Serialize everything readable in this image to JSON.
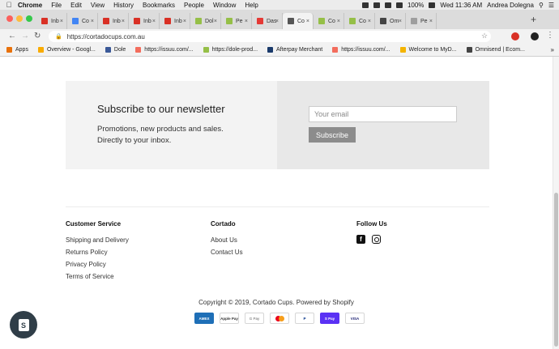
{
  "menubar": {
    "apple": "",
    "items": [
      "Chrome",
      "File",
      "Edit",
      "View",
      "History",
      "Bookmarks",
      "People",
      "Window",
      "Help"
    ],
    "battery": "100%",
    "clock": "Wed 11:36 AM",
    "user": "Andrea Dolegna"
  },
  "tabs": [
    {
      "label": "Inb",
      "color": "#d93025"
    },
    {
      "label": "Co",
      "color": "#4285f4"
    },
    {
      "label": "Inb",
      "color": "#d93025"
    },
    {
      "label": "Inb",
      "color": "#d93025"
    },
    {
      "label": "Inb",
      "color": "#d93025"
    },
    {
      "label": "Dol",
      "color": "#95bf47"
    },
    {
      "label": "Pe",
      "color": "#95bf47"
    },
    {
      "label": "Das",
      "color": "#e53935"
    },
    {
      "label": "Co",
      "color": "#555555"
    },
    {
      "label": "Co",
      "color": "#95bf47"
    },
    {
      "label": "Co",
      "color": "#95bf47"
    },
    {
      "label": "Om",
      "color": "#444444"
    },
    {
      "label": "Pe",
      "color": "#9e9e9e"
    }
  ],
  "address": {
    "url": "https://cortadocups.com.au"
  },
  "bookmarks": [
    {
      "label": "Apps",
      "color": "#e8710a"
    },
    {
      "label": "Overview - Googl...",
      "color": "#f9ab00"
    },
    {
      "label": "Dole",
      "color": "#3b5998"
    },
    {
      "label": "https://issuu.com/...",
      "color": "#f36d5d"
    },
    {
      "label": "https://dole-prod...",
      "color": "#95bf47"
    },
    {
      "label": "Afterpay Merchant",
      "color": "#1a3a6b"
    },
    {
      "label": "https://issuu.com/...",
      "color": "#f36d5d"
    },
    {
      "label": "Welcome to MyD...",
      "color": "#f4b400"
    },
    {
      "label": "Omnisend | Ecom...",
      "color": "#444444"
    }
  ],
  "bookmarks_more": "»",
  "newsletter": {
    "title": "Subscribe to our newsletter",
    "text": "Promotions, new products and sales. Directly to your inbox.",
    "email_placeholder": "Your email",
    "button": "Subscribe"
  },
  "footer": {
    "customer_service": {
      "heading": "Customer Service",
      "links": [
        "Shipping and Delivery",
        "Returns Policy",
        "Privacy Policy",
        "Terms of Service"
      ]
    },
    "cortado": {
      "heading": "Cortado",
      "links": [
        "About Us",
        "Contact Us"
      ]
    },
    "follow": {
      "heading": "Follow Us",
      "icons": [
        "facebook-icon",
        "instagram-icon"
      ]
    },
    "copyright": "Copyright © 2019, Cortado Cups. Powered by Shopify",
    "payments": [
      "AMEX",
      "Apple Pay",
      "G Pay",
      "Mastercard",
      "PayPal",
      "Shop Pay",
      "VISA"
    ]
  },
  "colors": {
    "newsletter_bg": "#f3f3f3",
    "newsletter_right_bg": "#e8e8e8",
    "button_bg": "#8c8c8c",
    "shopify_badge": "#303e48"
  }
}
